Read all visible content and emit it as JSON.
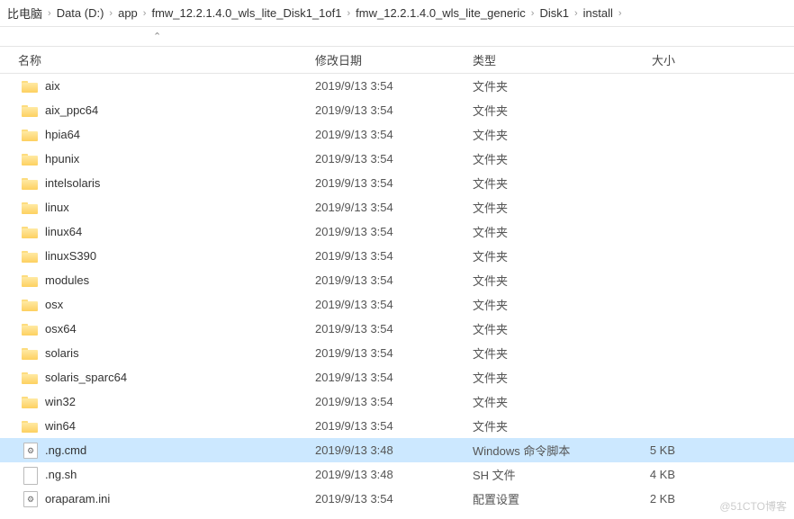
{
  "breadcrumb": {
    "items": [
      "比电脑",
      "Data (D:)",
      "app",
      "fmw_12.2.1.4.0_wls_lite_Disk1_1of1",
      "fmw_12.2.1.4.0_wls_lite_generic",
      "Disk1",
      "install"
    ]
  },
  "columns": {
    "name": "名称",
    "date": "修改日期",
    "type": "类型",
    "size": "大小"
  },
  "type_labels": {
    "folder": "文件夹",
    "cmd": "Windows 命令脚本",
    "sh": "SH 文件",
    "ini": "配置设置"
  },
  "files": [
    {
      "kind": "folder",
      "name": "aix",
      "date": "2019/9/13 3:54"
    },
    {
      "kind": "folder",
      "name": "aix_ppc64",
      "date": "2019/9/13 3:54"
    },
    {
      "kind": "folder",
      "name": "hpia64",
      "date": "2019/9/13 3:54"
    },
    {
      "kind": "folder",
      "name": "hpunix",
      "date": "2019/9/13 3:54"
    },
    {
      "kind": "folder",
      "name": "intelsolaris",
      "date": "2019/9/13 3:54"
    },
    {
      "kind": "folder",
      "name": "linux",
      "date": "2019/9/13 3:54"
    },
    {
      "kind": "folder",
      "name": "linux64",
      "date": "2019/9/13 3:54"
    },
    {
      "kind": "folder",
      "name": "linuxS390",
      "date": "2019/9/13 3:54"
    },
    {
      "kind": "folder",
      "name": "modules",
      "date": "2019/9/13 3:54"
    },
    {
      "kind": "folder",
      "name": "osx",
      "date": "2019/9/13 3:54"
    },
    {
      "kind": "folder",
      "name": "osx64",
      "date": "2019/9/13 3:54"
    },
    {
      "kind": "folder",
      "name": "solaris",
      "date": "2019/9/13 3:54"
    },
    {
      "kind": "folder",
      "name": "solaris_sparc64",
      "date": "2019/9/13 3:54"
    },
    {
      "kind": "folder",
      "name": "win32",
      "date": "2019/9/13 3:54"
    },
    {
      "kind": "folder",
      "name": "win64",
      "date": "2019/9/13 3:54"
    },
    {
      "kind": "cmd",
      "name": ".ng.cmd",
      "date": "2019/9/13 3:48",
      "size": "5 KB",
      "selected": true
    },
    {
      "kind": "sh",
      "name": ".ng.sh",
      "date": "2019/9/13 3:48",
      "size": "4 KB"
    },
    {
      "kind": "ini",
      "name": "oraparam.ini",
      "date": "2019/9/13 3:54",
      "size": "2 KB"
    }
  ],
  "watermark": "@51CTO博客"
}
